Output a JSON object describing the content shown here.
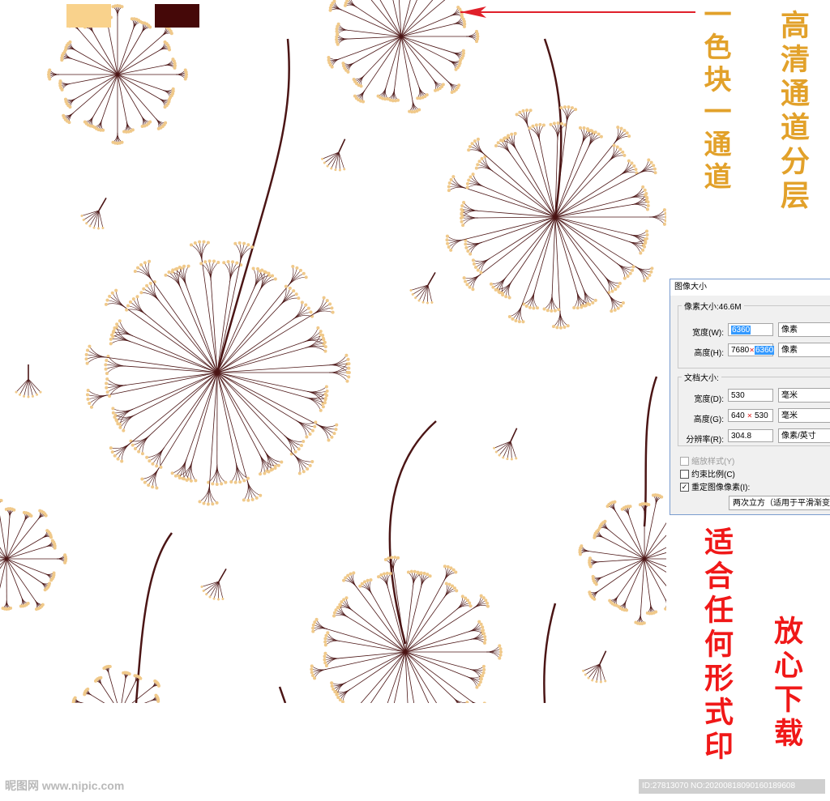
{
  "palette": {
    "swatch_light": "#f9d28c",
    "swatch_dark": "#450808",
    "fluff": "#f0c98a",
    "stem": "#4b1515",
    "arrow": "#e0202a",
    "gold_text": "#e2a12a",
    "red_text": "#f01818"
  },
  "annotations": {
    "color_block_note": "一色块一通道",
    "hd_channels_note": "高清通道分层",
    "print_note": "适合任何形式印",
    "download_note": "放心下载"
  },
  "image_size_dialog": {
    "title": "图像大小",
    "pixel_dimensions_label": "像素大小:46.6M",
    "width_label": "宽度(W):",
    "width_value": "6360",
    "width_unit": "像素",
    "height_label": "高度(H):",
    "height_value_old": "7680",
    "height_value_new": "6360",
    "height_unit": "像素",
    "document_size_label": "文档大小:",
    "doc_width_label": "宽度(D):",
    "doc_width_value": "530",
    "doc_width_unit": "毫米",
    "doc_height_label": "高度(G):",
    "doc_height_value_old": "640",
    "doc_height_value_new": "530",
    "doc_height_unit": "毫米",
    "resolution_label": "分辨率(R):",
    "resolution_value": "304.8",
    "resolution_unit": "像素/英寸",
    "scale_styles_label": "缩放样式(Y)",
    "constrain_label": "约束比例(C)",
    "resample_label": "重定图像像素(I):",
    "resample_method": "两次立方（适用于平滑渐变"
  },
  "watermark": {
    "site": "昵图网 www.nipic.com",
    "id_text": "ID:27813070 NO:20200818090160189608"
  }
}
